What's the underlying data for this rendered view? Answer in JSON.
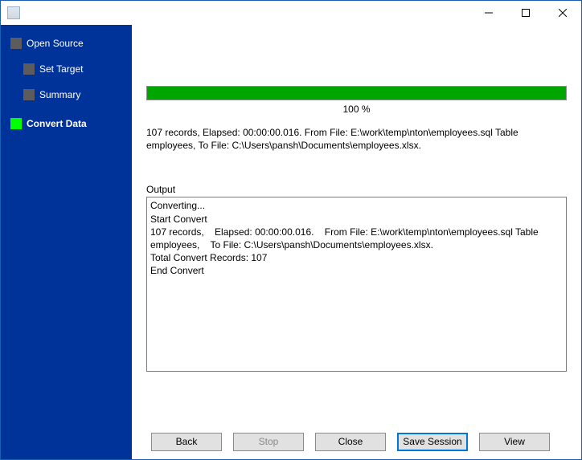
{
  "sidebar": {
    "items": [
      {
        "label": "Open Source",
        "active": false
      },
      {
        "label": "Set Target",
        "active": false
      },
      {
        "label": "Summary",
        "active": false
      },
      {
        "label": "Convert Data",
        "active": true
      }
    ]
  },
  "progress": {
    "percent": 100,
    "label": "100 %"
  },
  "summary_text": "107 records,    Elapsed: 00:00:00.016.    From File: E:\\work\\temp\\nton\\employees.sql Table employees,    To File: C:\\Users\\pansh\\Documents\\employees.xlsx.",
  "output": {
    "label": "Output",
    "text": "Converting...\nStart Convert\n107 records,    Elapsed: 00:00:00.016.    From File: E:\\work\\temp\\nton\\employees.sql Table employees,    To File: C:\\Users\\pansh\\Documents\\employees.xlsx.\nTotal Convert Records: 107\nEnd Convert"
  },
  "buttons": {
    "back": "Back",
    "stop": "Stop",
    "close": "Close",
    "save_session": "Save Session",
    "view": "View"
  }
}
